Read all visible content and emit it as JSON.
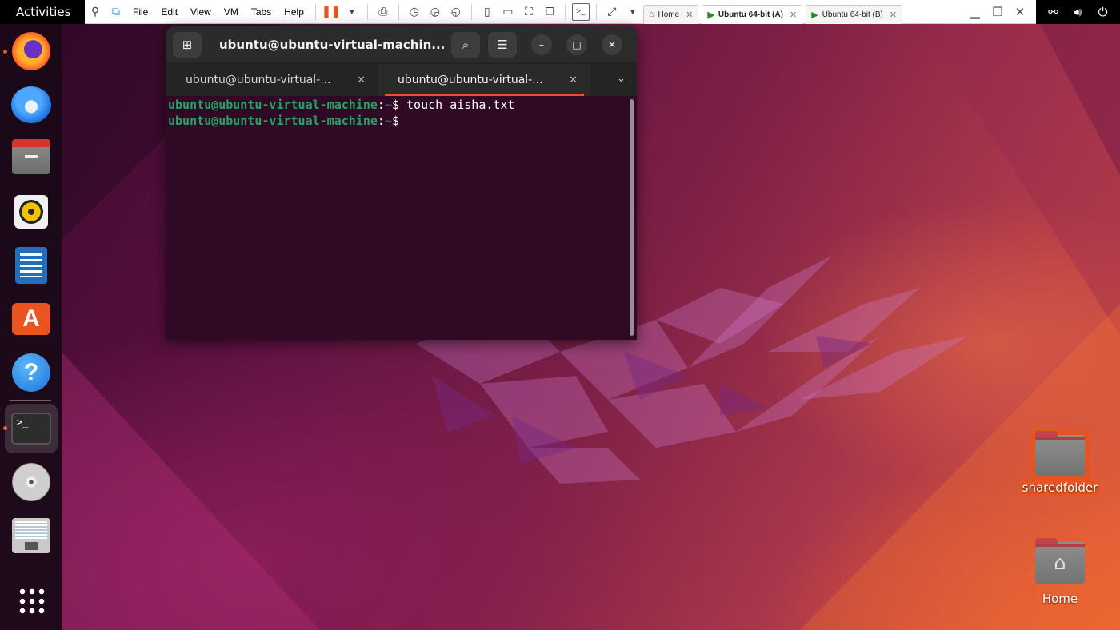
{
  "gnome": {
    "activities_label": "Activities",
    "tray_icons": [
      "network-icon",
      "volume-icon",
      "power-icon"
    ]
  },
  "vmware": {
    "menus": [
      "File",
      "Edit",
      "View",
      "VM",
      "Tabs",
      "Help"
    ],
    "tabs": [
      {
        "label": "Home",
        "icon": "home-icon",
        "active": false
      },
      {
        "label": "Ubuntu 64-bit (A)",
        "icon": "vm-running-icon",
        "active": true
      },
      {
        "label": "Ubuntu 64-bit (B)",
        "icon": "vm-running-icon",
        "active": false
      }
    ]
  },
  "dock": {
    "apps": [
      "firefox",
      "thunderbird",
      "files",
      "rhythmbox",
      "libreoffice-writer",
      "app-center",
      "help",
      "terminal",
      "dvd",
      "floppy-save",
      "show-apps"
    ],
    "running": [
      "firefox",
      "terminal"
    ],
    "active": "terminal"
  },
  "terminal": {
    "title": "ubuntu@ubuntu-virtual-machin...",
    "tabs": [
      {
        "label": "ubuntu@ubuntu-virtual-...",
        "active": false
      },
      {
        "label": "ubuntu@ubuntu-virtual-...",
        "active": true
      }
    ],
    "lines": [
      {
        "user": "ubuntu@ubuntu-virtual-machine",
        "sep": ":",
        "path": "~",
        "symbol": "$",
        "command": " touch aisha.txt"
      },
      {
        "user": "ubuntu@ubuntu-virtual-machine",
        "sep": ":",
        "path": "~",
        "symbol": "$",
        "command": ""
      }
    ]
  },
  "desktop": {
    "icons": [
      {
        "label": "sharedfolder",
        "selected": true
      },
      {
        "label": "Home",
        "selected": false
      }
    ]
  },
  "colors": {
    "accent": "#e95420",
    "terminal_bg": "#300a24",
    "prompt_user": "#26a269",
    "prompt_path": "#3465a4"
  }
}
